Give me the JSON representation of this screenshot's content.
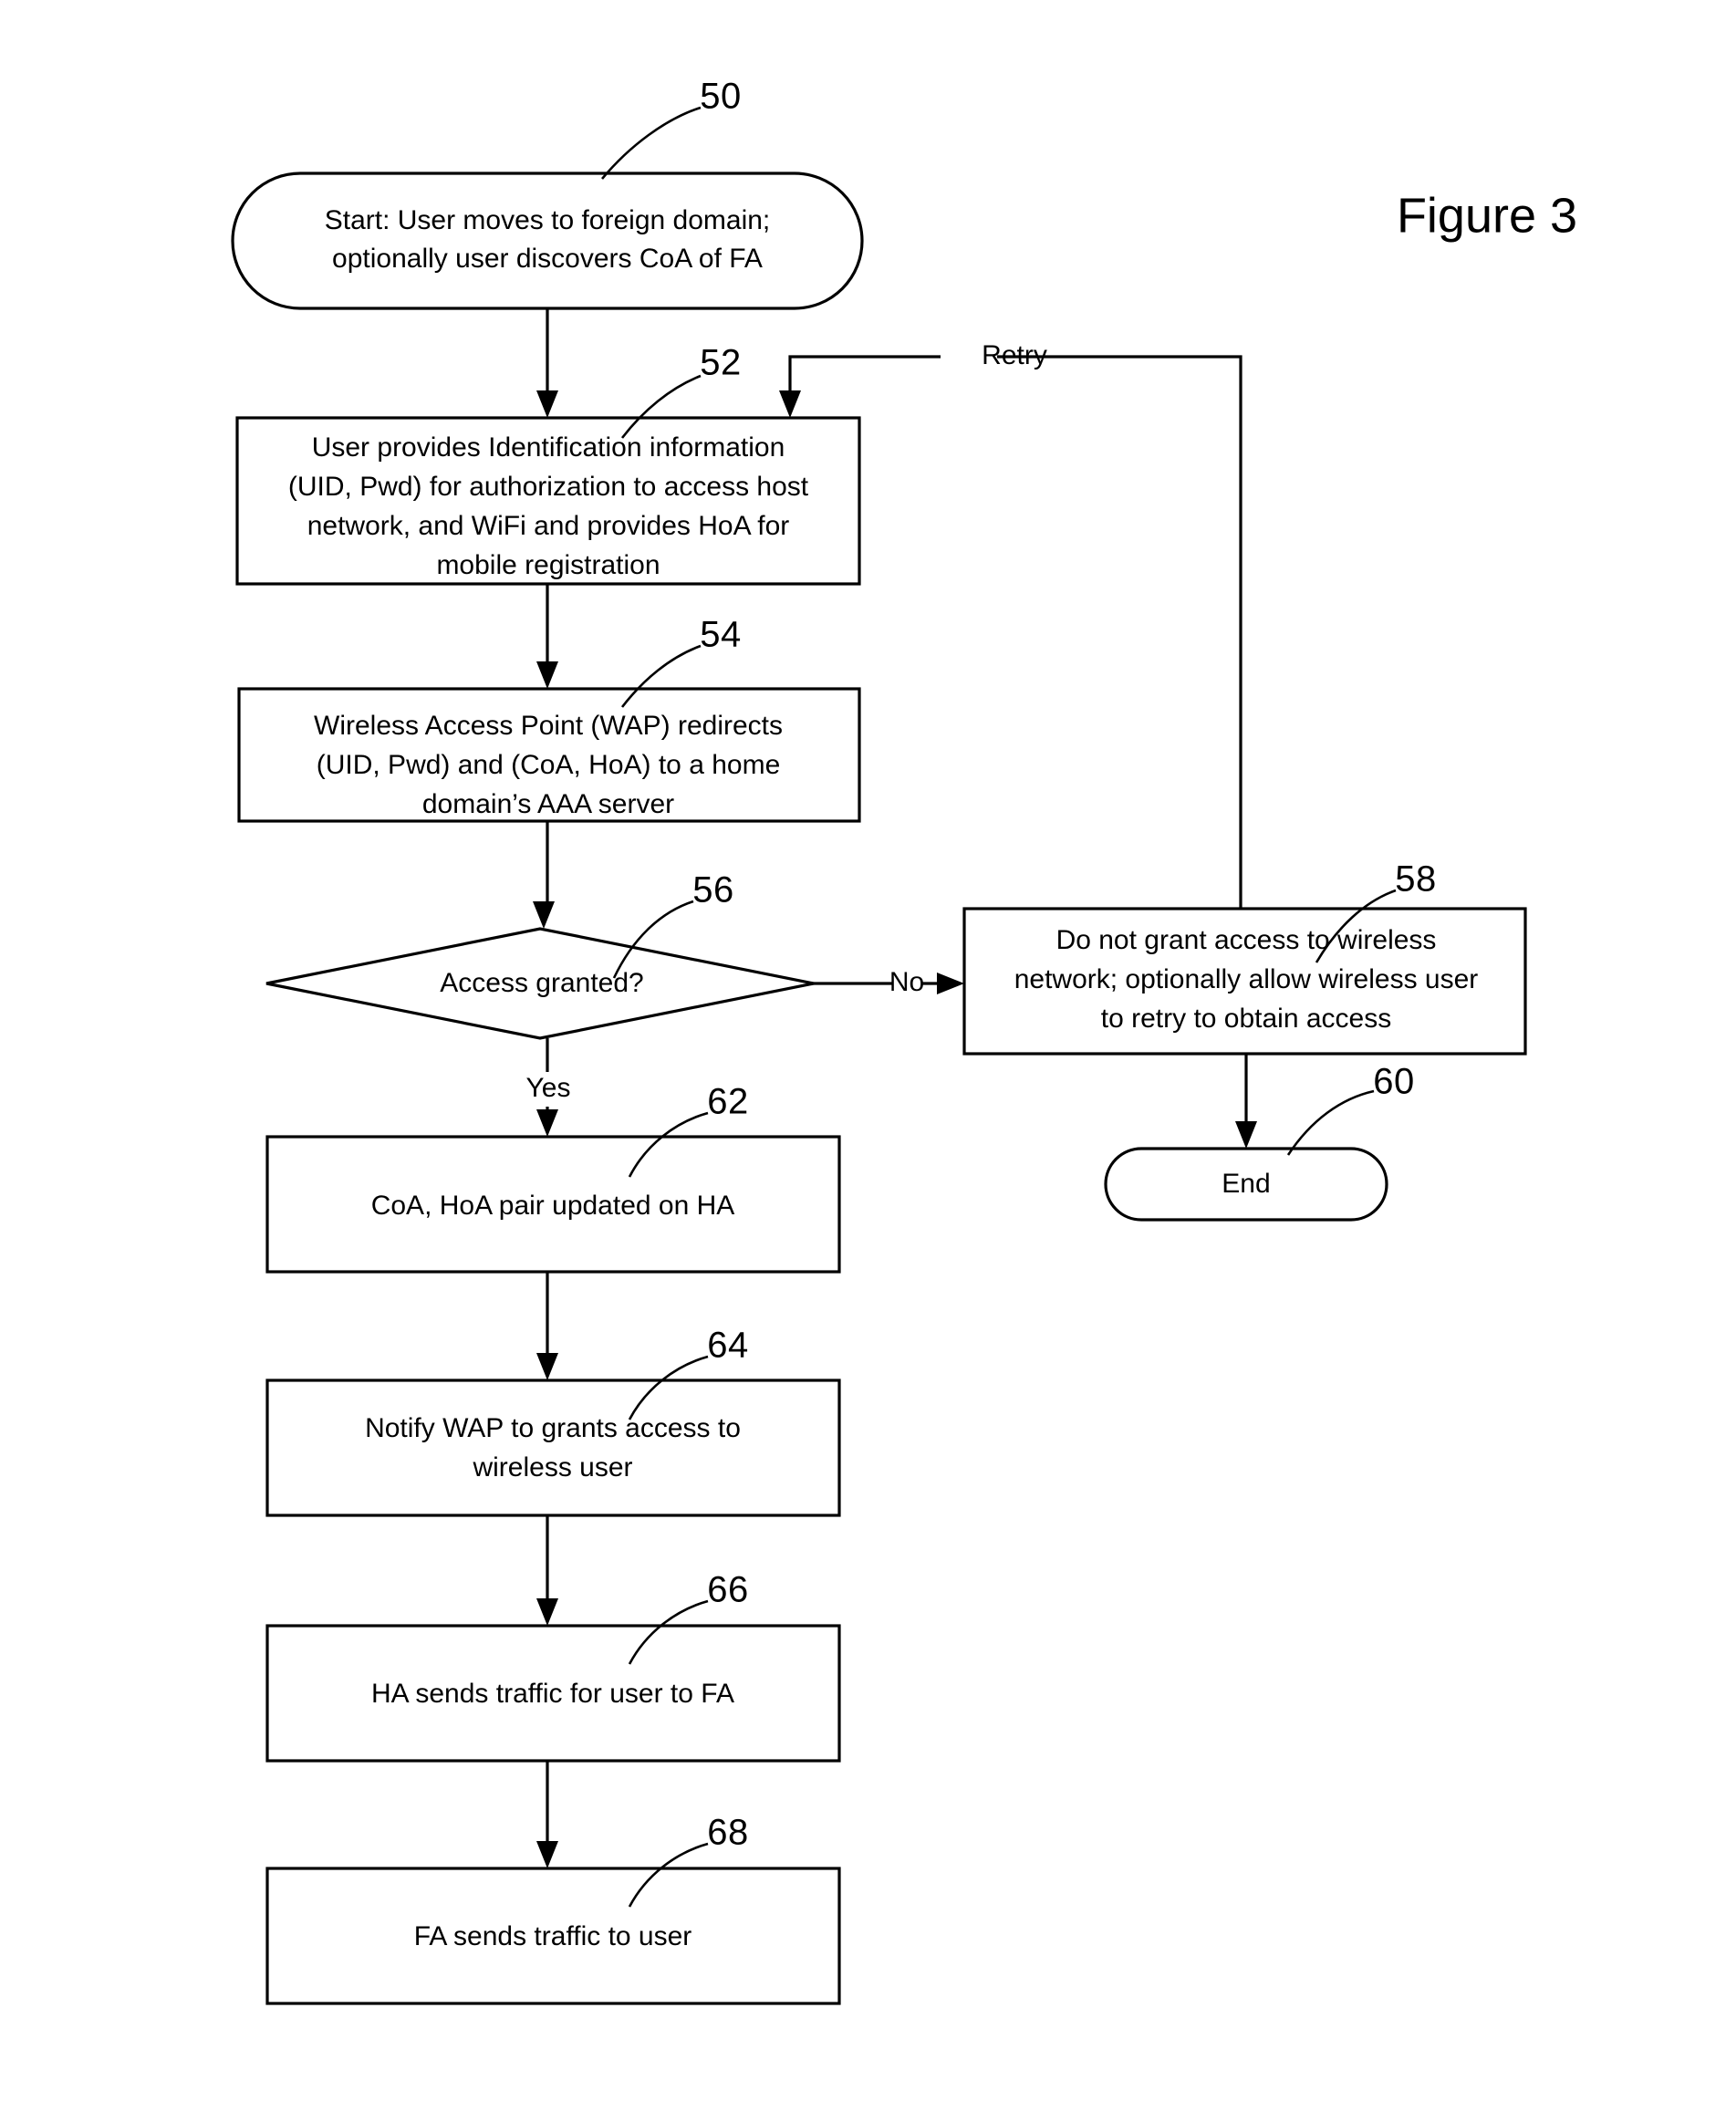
{
  "figure": {
    "title": "Figure 3"
  },
  "nodes": [
    {
      "id": "start",
      "ref": "50",
      "shape": "terminator",
      "lines": [
        "Start:  User moves to foreign domain;",
        "optionally user discovers CoA of FA"
      ]
    },
    {
      "id": "identify",
      "ref": "52",
      "shape": "process",
      "lines": [
        "User provides Identification information",
        "(UID, Pwd) for authorization to access host",
        "network, and WiFi and provides HoA for",
        "mobile registration"
      ]
    },
    {
      "id": "redirect",
      "ref": "54",
      "shape": "process",
      "lines": [
        "Wireless Access Point (WAP) redirects",
        "(UID, Pwd) and (CoA, HoA) to a home",
        "domain’s AAA server"
      ]
    },
    {
      "id": "decision",
      "ref": "56",
      "shape": "decision",
      "lines": [
        "Access granted?"
      ]
    },
    {
      "id": "deny",
      "ref": "58",
      "shape": "process",
      "lines": [
        "Do not grant access to wireless",
        "network; optionally allow wireless user",
        "to retry to obtain access"
      ]
    },
    {
      "id": "end",
      "ref": "60",
      "shape": "terminator",
      "lines": [
        "End"
      ]
    },
    {
      "id": "update",
      "ref": "62",
      "shape": "process",
      "lines": [
        "CoA, HoA pair updated on HA"
      ]
    },
    {
      "id": "notify",
      "ref": "64",
      "shape": "process",
      "lines": [
        "Notify WAP to grants access to",
        "wireless user"
      ]
    },
    {
      "id": "ha-traffic",
      "ref": "66",
      "shape": "process",
      "lines": [
        "HA sends traffic for user to FA"
      ]
    },
    {
      "id": "fa-traffic",
      "ref": "68",
      "shape": "process",
      "lines": [
        "FA sends traffic to user"
      ]
    }
  ],
  "edge_labels": {
    "retry": "Retry",
    "no": "No",
    "yes": "Yes"
  },
  "colors": {
    "stroke": "#000000",
    "fill": "#ffffff"
  }
}
